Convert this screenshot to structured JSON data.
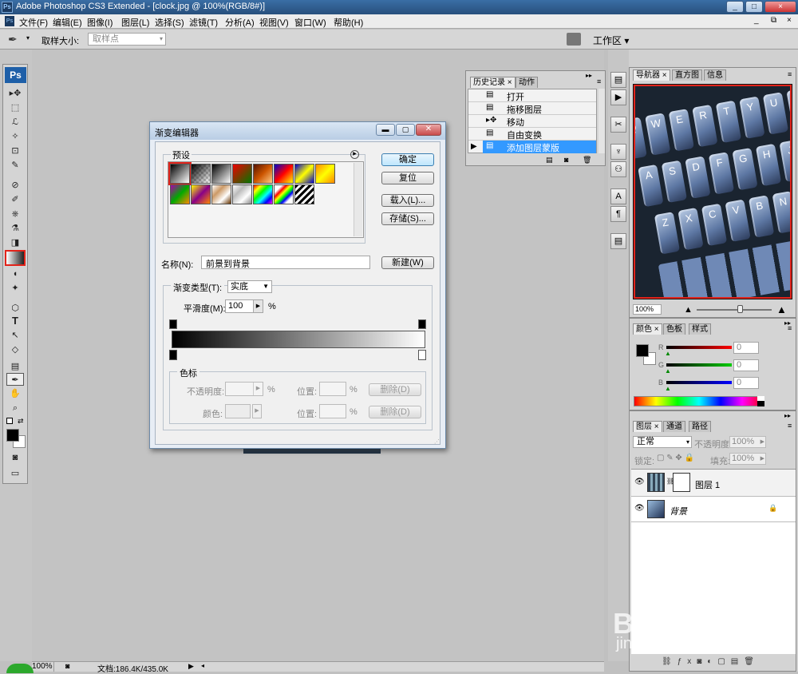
{
  "app": {
    "title": "Adobe Photoshop CS3 Extended - [clock.jpg @ 100%(RGB/8#)]",
    "ps_logo": "Ps",
    "window_buttons": [
      "_",
      "□",
      "×"
    ],
    "doc_buttons": [
      "_",
      "⧉",
      "×"
    ]
  },
  "menu": [
    "文件(F)",
    "编辑(E)",
    "图像(I)",
    "图层(L)",
    "选择(S)",
    "滤镜(T)",
    "分析(A)",
    "视图(V)",
    "窗口(W)",
    "帮助(H)"
  ],
  "options": {
    "sample_size_label": "取样大小:",
    "sample_size_value": "取样点",
    "workspace_label": "工作区 ▾"
  },
  "dialog": {
    "title": "渐变编辑器",
    "presets_label": "预设",
    "ok": "确定",
    "reset": "复位",
    "load": "载入(L)...",
    "save": "存储(S)...",
    "name_label": "名称(N):",
    "name_value": "前景到背景",
    "new": "新建(W)",
    "type_label": "渐变类型(T):",
    "type_value": "实底",
    "smooth_label": "平滑度(M):",
    "smooth_value": "100",
    "smooth_unit": "%",
    "stops_label": "色标",
    "opacity_label": "不透明度:",
    "pct1": "%",
    "pos1_label": "位置:",
    "pct2": "%",
    "delete1": "删除(D)",
    "color_label": "颜色:",
    "pos2_label": "位置:",
    "pct3": "%",
    "delete2": "删除(D)"
  },
  "history": {
    "tabs": [
      "历史记录",
      "动作"
    ],
    "items": [
      "打开",
      "拖移图层",
      "移动",
      "自由变换",
      "添加图层蒙版"
    ]
  },
  "navigator": {
    "tabs": [
      "导航器",
      "直方图",
      "信息"
    ],
    "zoom": "100%",
    "keys": [
      [
        "Q",
        "W",
        "E",
        "R",
        "T",
        "Y",
        "U",
        "I"
      ],
      [
        "A",
        "S",
        "D",
        "F",
        "G",
        "H",
        "J",
        "K"
      ],
      [
        "Z",
        "X",
        "C",
        "V",
        "B",
        "N",
        "M",
        "<"
      ]
    ]
  },
  "color_panel": {
    "tabs": [
      "颜色",
      "色板",
      "样式"
    ],
    "r_label": "R",
    "r_value": "0",
    "g_label": "G",
    "g_value": "0",
    "b_label": "B",
    "b_value": "0"
  },
  "layers": {
    "tabs": [
      "图层",
      "通道",
      "路径"
    ],
    "blend_mode": "正常",
    "opacity_label": "不透明度:",
    "opacity_value": "100%",
    "lock_label": "锁定:",
    "fill_label": "填充:",
    "fill_value": "100%",
    "items": [
      "图层 1",
      "背景"
    ]
  },
  "status": {
    "zoom": "100%",
    "doc": "文档:186.4K/435.0K"
  },
  "toolbox": {
    "tools": [
      "▸✥",
      "⬚",
      "ℒ",
      "✧",
      "⊡",
      "✎",
      "⊘",
      "✐",
      "⎈",
      "⚗",
      "◨",
      "▮",
      "◖",
      "✦",
      "⬡",
      "T",
      "↖",
      "◇",
      "▤",
      "✒",
      "✋",
      "⌕"
    ]
  },
  "watermark": {
    "brand": "Bai du 经验",
    "url": "jingyan.baidu.com"
  },
  "colors": {
    "accent": "#3399ff",
    "highlight": "#e2231a",
    "history_selected": "#3399ff"
  }
}
